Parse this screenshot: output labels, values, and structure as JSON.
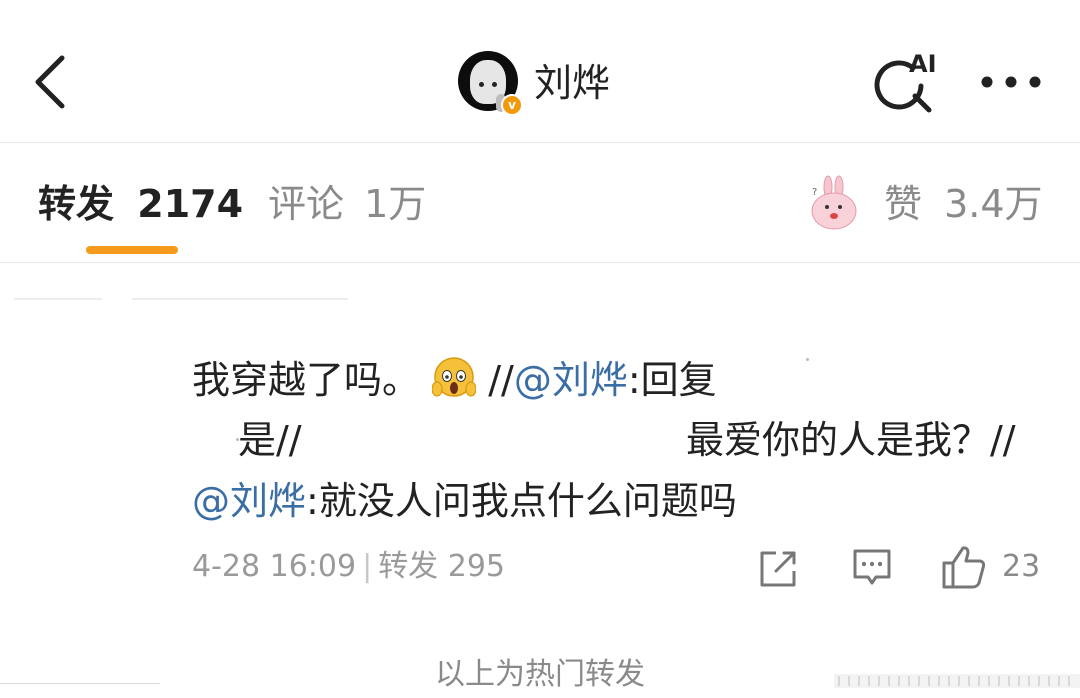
{
  "header": {
    "back_icon": "chevron-left-icon",
    "user_name": "刘烨",
    "verified_badge": "v",
    "ai_search_icon": "ai-search-icon",
    "ai_label": "AI",
    "more_icon": "more-icon"
  },
  "tabs": {
    "repost_label": "转发",
    "repost_count": "2174",
    "comment_label": "评论",
    "comment_count": "1万",
    "like_label": "赞",
    "like_count": "3.4万",
    "active": "repost",
    "accent": "#f59a1b"
  },
  "post": {
    "line1_text": "我穿越了吗。",
    "line1_sep": "//",
    "line1_mention": "@刘烨",
    "line1_rest": ":回复",
    "line2_left": "是//",
    "line2_right": "最爱你的人是我？//",
    "line3_mention": "@刘烨",
    "line3_rest": ":就没人问我点什么问题吗",
    "mention_color": "#3b6ea5",
    "timestamp": "4-28 16:09",
    "separator": "|",
    "repost_label": "转发",
    "repost_count": "295",
    "like_count": "23"
  },
  "footer": {
    "text": "以上为热门转发"
  }
}
